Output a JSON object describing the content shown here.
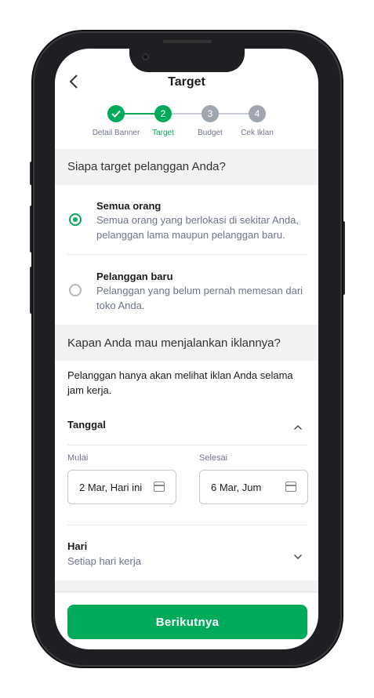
{
  "header": {
    "title": "Target",
    "back_icon": "chevron-left-icon"
  },
  "stepper": {
    "active_color": "#00aa5b",
    "inactive_color": "#9fa6b0",
    "steps": [
      {
        "number": "✓",
        "label": "Detail Banner",
        "state": "done"
      },
      {
        "number": "2",
        "label": "Target",
        "state": "active"
      },
      {
        "number": "3",
        "label": "Budget",
        "state": "pending"
      },
      {
        "number": "4",
        "label": "Cek Iklan",
        "state": "pending"
      }
    ]
  },
  "target_section": {
    "title": "Siapa target pelanggan Anda?",
    "options": [
      {
        "title": "Semua orang",
        "desc": "Semua orang yang berlokasi di sekitar Anda, pelanggan lama maupun pelanggan baru.",
        "selected": true
      },
      {
        "title": "Pelanggan baru",
        "desc": "Pelanggan yang belum pernah memesan dari toko Anda.",
        "selected": false
      }
    ]
  },
  "schedule_section": {
    "title": "Kapan Anda mau menjalankan iklannya?",
    "info": "Pelanggan hanya akan melihat iklan Anda selama jam kerja.",
    "date": {
      "label": "Tanggal",
      "start_label": "Mulai",
      "start_value": "2 Mar, Hari ini",
      "end_label": "Selesai",
      "end_value": "6 Mar, Jum"
    },
    "days": {
      "label": "Hari",
      "value": "Setiap hari kerja"
    }
  },
  "footer": {
    "next_label": "Berikutnya"
  }
}
